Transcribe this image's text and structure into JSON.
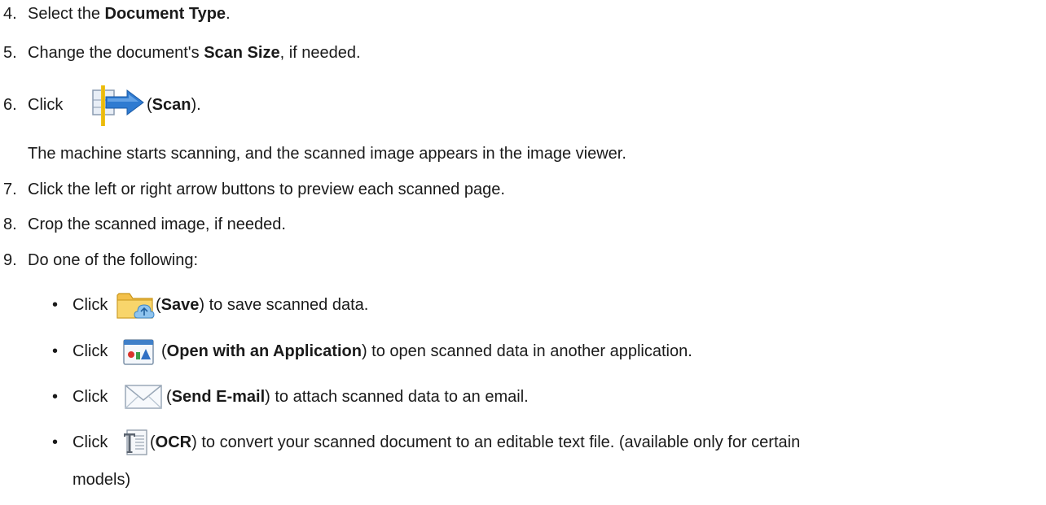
{
  "steps": {
    "s4": {
      "num": "4.",
      "pre": "Select the ",
      "bold": "Document Type",
      "post": "."
    },
    "s5": {
      "num": "5.",
      "pre": "Change the document's ",
      "bold": "Scan Size",
      "post": ", if needed."
    },
    "s6": {
      "num": "6.",
      "pre": "Click ",
      "open": " (",
      "bold": "Scan",
      "post": ")."
    },
    "s6_note": "The machine starts scanning, and the scanned image appears in the image viewer.",
    "s7": {
      "num": "7.",
      "text": "Click the left or right arrow buttons to preview each scanned page."
    },
    "s8": {
      "num": "8.",
      "text": "Crop the scanned image, if needed."
    },
    "s9": {
      "num": "9.",
      "text": "Do one of the following:"
    }
  },
  "bullets": [
    {
      "bullet": "•",
      "pre": "Click",
      "open": " (",
      "bold": "Save",
      "post": ") to save scanned data.",
      "icon": "folder-save-icon"
    },
    {
      "bullet": "•",
      "pre": "Click ",
      "open": " (",
      "bold": "Open with an Application",
      "post": ") to open scanned data in another application.",
      "icon": "open-application-icon"
    },
    {
      "bullet": "•",
      "pre": "Click ",
      "open": " (",
      "bold": "Send E-mail",
      "post": ") to attach scanned data to an email.",
      "icon": "envelope-icon"
    },
    {
      "bullet": "•",
      "pre": "Click ",
      "open": " (",
      "bold": "OCR",
      "post": ") to convert your scanned document to an editable text file. (available only for certain",
      "icon": "ocr-icon"
    }
  ],
  "bullet_continuation": "models)"
}
